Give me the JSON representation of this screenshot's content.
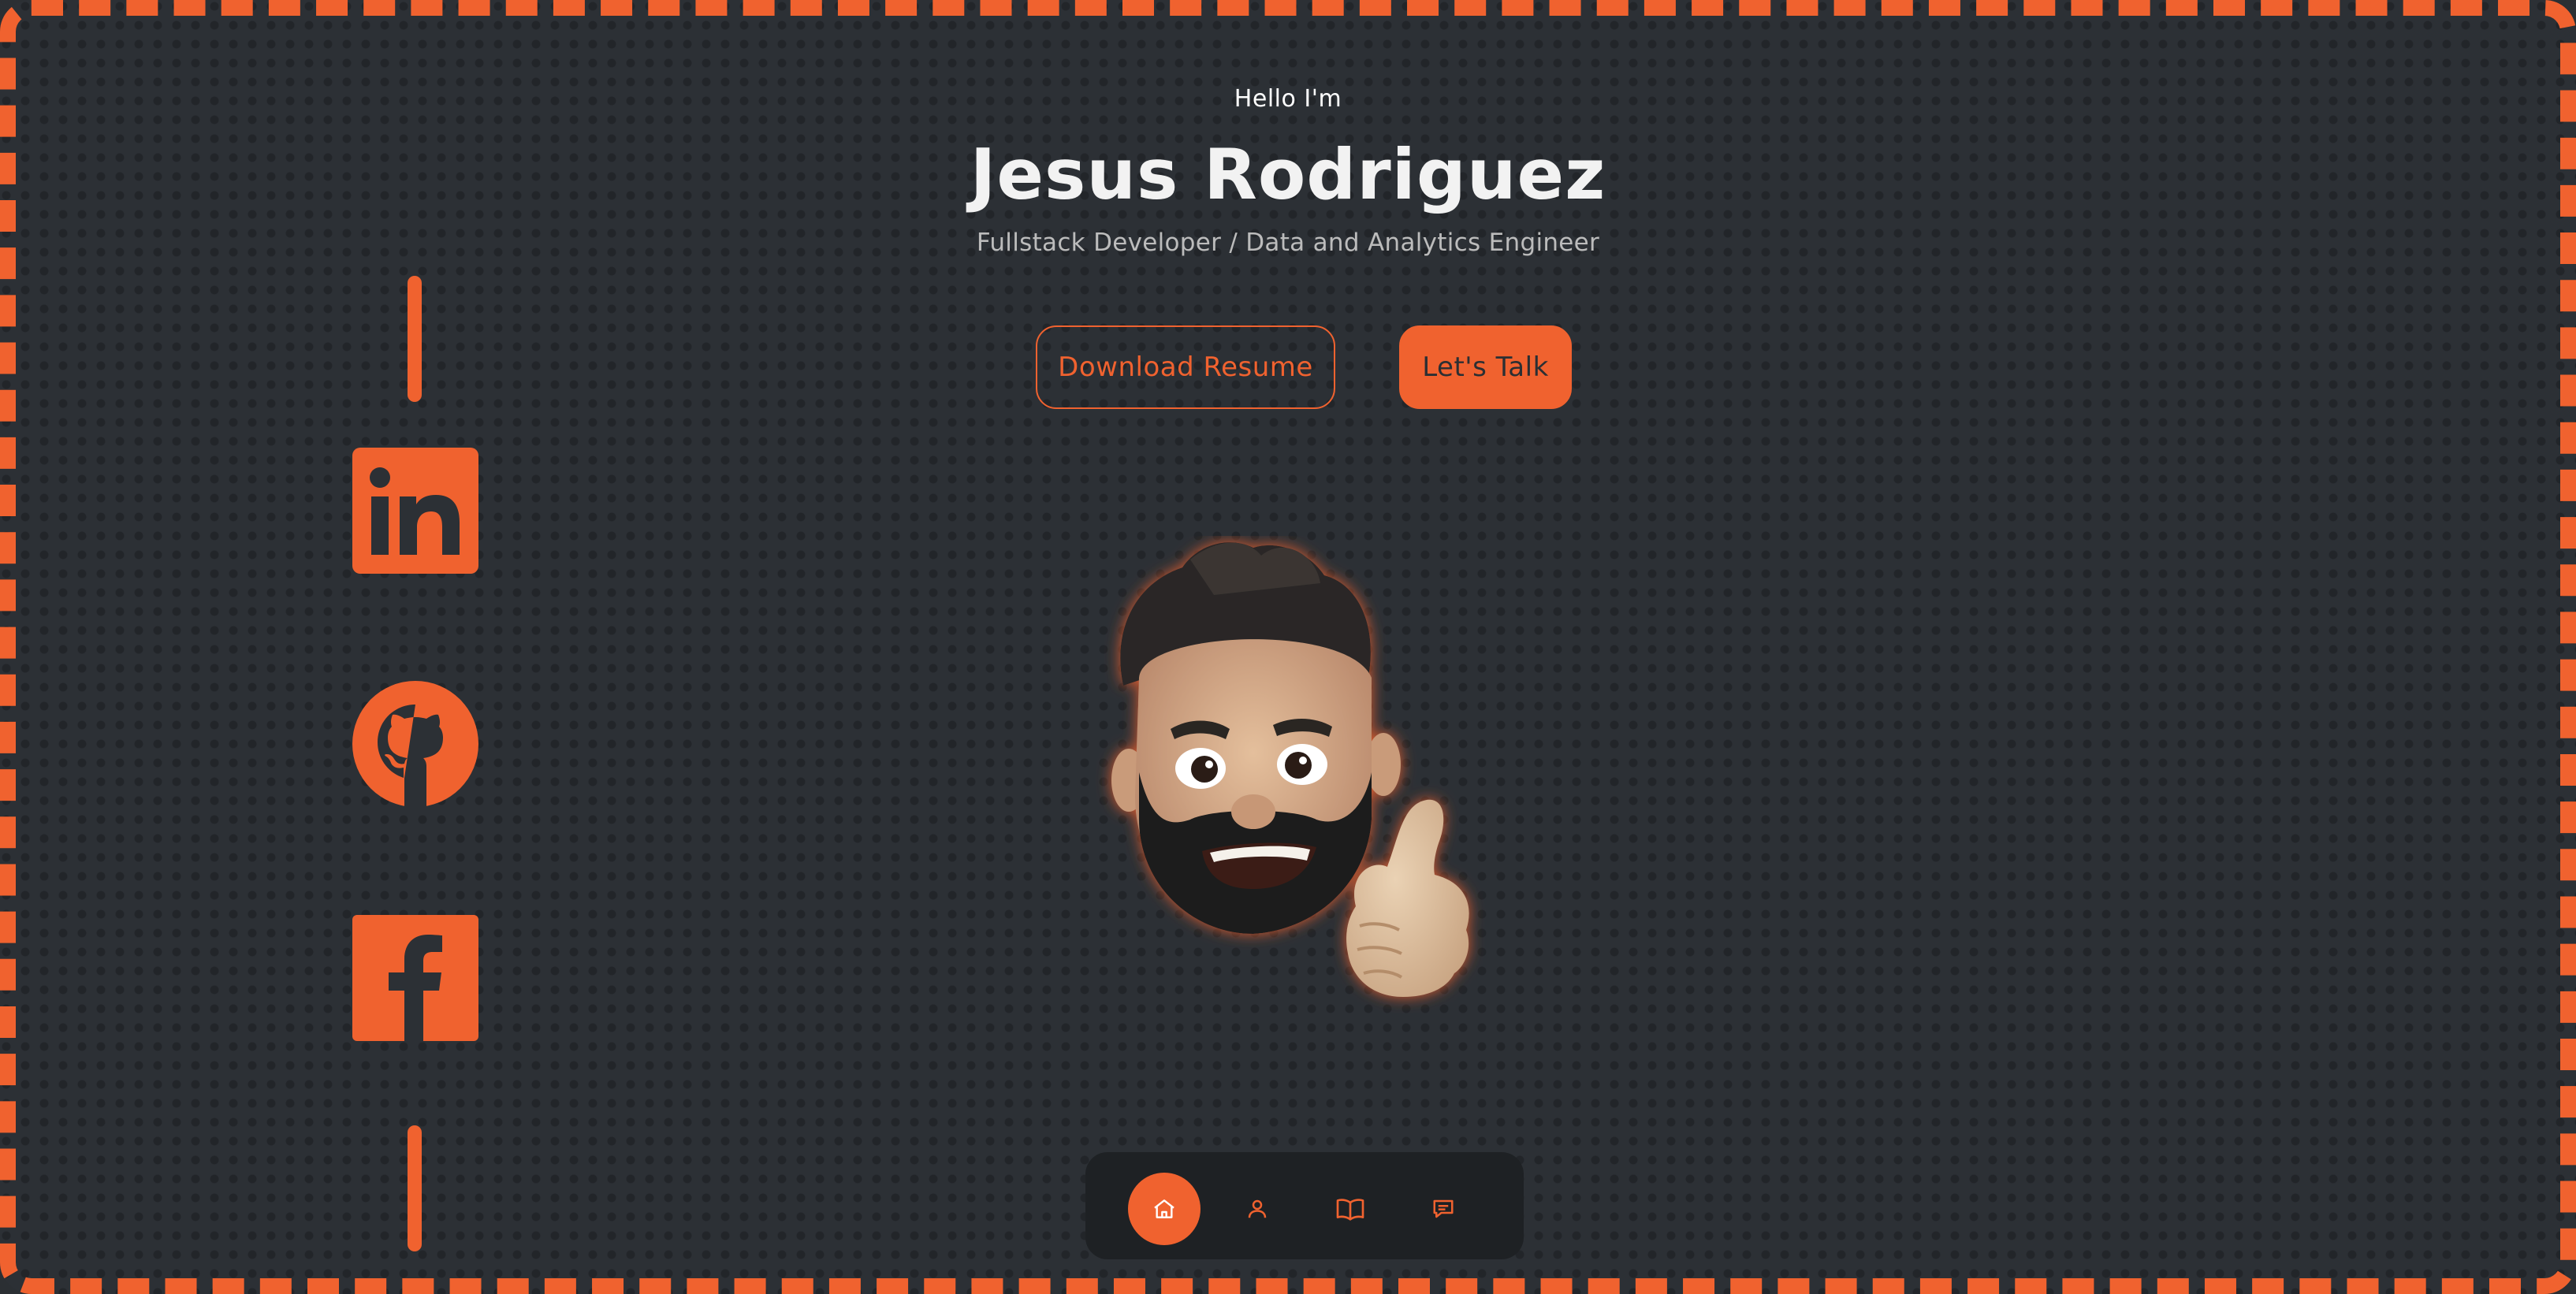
{
  "hero": {
    "greeting": "Hello I'm",
    "name": "Jesus Rodriguez",
    "role": "Fullstack Developer / Data and Analytics Engineer"
  },
  "actions": {
    "resume_label": "Download Resume",
    "talk_label": "Let's Talk"
  },
  "social": [
    {
      "icon": "linkedin-icon"
    },
    {
      "icon": "github-icon"
    },
    {
      "icon": "facebook-icon"
    }
  ],
  "nav": [
    {
      "icon": "home-icon",
      "active": true
    },
    {
      "icon": "user-icon",
      "active": false
    },
    {
      "icon": "book-icon",
      "active": false
    },
    {
      "icon": "message-icon",
      "active": false
    }
  ],
  "colors": {
    "accent": "#f0622f",
    "background": "#2c3035",
    "navbar": "#1e2124",
    "text": "#f2f2f2",
    "muted": "#bcbcbc"
  }
}
